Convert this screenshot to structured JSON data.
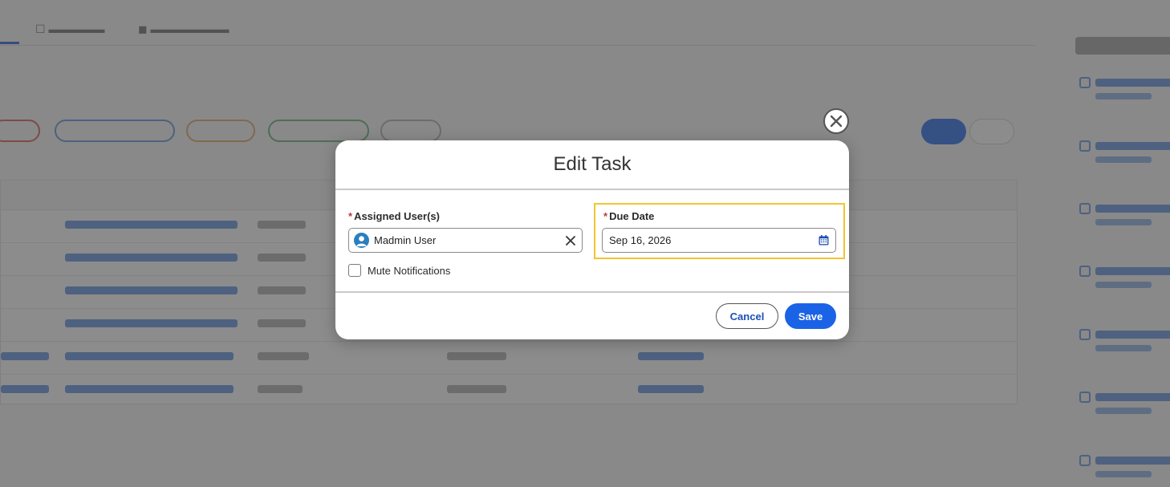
{
  "modal": {
    "title": "Edit Task",
    "assigned_label": "Assigned User(s)",
    "assigned_required_mark": "*",
    "assigned_user": "Madmin User",
    "mute_label": "Mute Notifications",
    "mute_checked": false,
    "due_label": "Due Date",
    "due_required_mark": "*",
    "due_value": "Sep 16, 2026",
    "cancel_label": "Cancel",
    "save_label": "Save"
  },
  "icons": {
    "close": "close-icon",
    "avatar": "user-avatar-icon",
    "clear": "clear-icon",
    "calendar": "calendar-icon"
  },
  "colors": {
    "accent": "#1b63e6",
    "required": "#c23934",
    "highlight": "#f4c430",
    "overlay": "#6e6e6e"
  }
}
